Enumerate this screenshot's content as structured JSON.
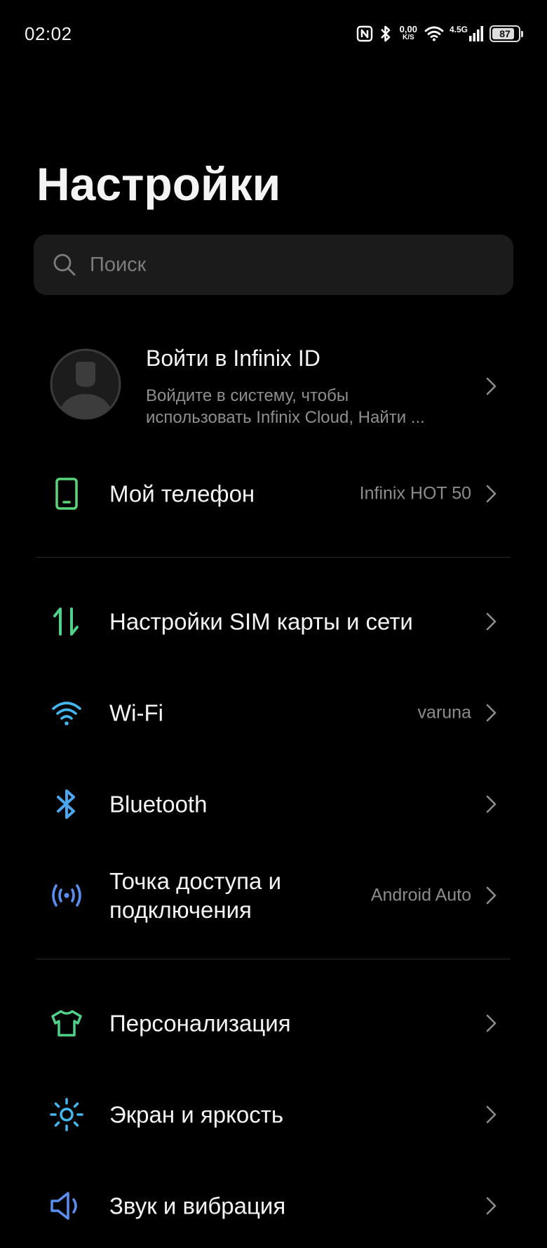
{
  "status_bar": {
    "time": "02:02",
    "net_speed_value": "0,00",
    "net_speed_unit": "K/S",
    "network_type": "4.5G",
    "battery_level": "87",
    "battery_fraction": 0.87,
    "icons": [
      "nfc-icon",
      "bluetooth-icon",
      "wifi-icon",
      "cellular-signal-icon",
      "battery-icon"
    ]
  },
  "header": {
    "title": "Настройки"
  },
  "search": {
    "placeholder": "Поиск",
    "value": ""
  },
  "account": {
    "title": "Войти в Infinix ID",
    "subtitle_line1": "Войдите в систему, чтобы",
    "subtitle_line2": "использовать Infinix Cloud, Найти ..."
  },
  "items": [
    {
      "label": "Мой телефон",
      "value": "Infinix HOT 50",
      "icon": "phone-icon",
      "icon_color": "#59d67a"
    },
    {
      "label": "Настройки SIM карты и сети",
      "value": "",
      "icon": "sim-network-icon",
      "icon_color": "#4fd18a"
    },
    {
      "label": "Wi-Fi",
      "value": "varuna",
      "icon": "wifi-icon",
      "icon_color": "#43b8f0"
    },
    {
      "label": "Bluetooth",
      "value": "",
      "icon": "bluetooth-icon",
      "icon_color": "#4aa6ee"
    },
    {
      "label_line1": "Точка доступа и",
      "label_line2": "подключения",
      "value": "Android Auto",
      "icon": "hotspot-icon",
      "icon_color": "#5a8ff0"
    },
    {
      "label": "Персонализация",
      "value": "",
      "icon": "tshirt-icon",
      "icon_color": "#4fd18a"
    },
    {
      "label": "Экран и яркость",
      "value": "",
      "icon": "brightness-icon",
      "icon_color": "#43b8f0"
    },
    {
      "label": "Звук и вибрация",
      "value": "",
      "icon": "speaker-icon",
      "icon_color": "#5a8ff0"
    }
  ],
  "colors": {
    "background": "#000000",
    "search_background": "#1b1b1b",
    "secondary_text": "#8c8c8c",
    "divider": "#2a2a2a"
  }
}
